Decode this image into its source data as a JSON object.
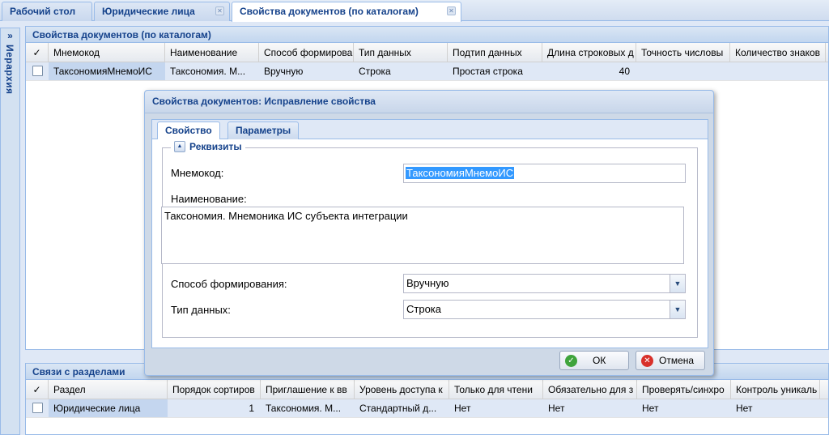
{
  "tabs": [
    {
      "label": "Рабочий стол"
    },
    {
      "label": "Юридические лица"
    },
    {
      "label": "Свойства документов (по каталогам)"
    }
  ],
  "left_region": {
    "title": "Иерархия",
    "expand_glyph": "»"
  },
  "properties_panel": {
    "title": "Свойства документов (по каталогам)",
    "columns": [
      "Мнемокод",
      "Наименование",
      "Способ формирова",
      "Тип данных",
      "Подтип данных",
      "Длина строковых д",
      "Точность числовы",
      "Количество знаков"
    ],
    "rows": [
      {
        "mnemocode": "ТаксономияМнемоИС",
        "name": "Таксономия. М...",
        "method": "Вручную",
        "data_type": "Строка",
        "subtype": "Простая строка",
        "length": "40",
        "precision": "",
        "digits": ""
      }
    ]
  },
  "links_panel": {
    "title": "Связи с разделами",
    "columns": [
      "Раздел",
      "Порядок сортиров",
      "Приглашение к вв",
      "Уровень доступа к",
      "Только для чтени",
      "Обязательно для з",
      "Проверять/синхро",
      "Контроль уникаль"
    ],
    "rows": [
      {
        "section": "Юридические лица",
        "order": "1",
        "prompt": "Таксономия. М...",
        "access": "Стандартный д...",
        "readonly": "Нет",
        "required": "Нет",
        "check": "Нет",
        "unique": "Нет"
      }
    ]
  },
  "dialog": {
    "title": "Свойства документов: Исправление свойства",
    "tabs": [
      "Свойство",
      "Параметры"
    ],
    "fieldset_title": "Реквизиты",
    "fields": {
      "mnemocode_label": "Мнемокод:",
      "mnemocode_value": "ТаксономияМнемоИС",
      "name_label": "Наименование:",
      "name_value": "Таксономия. Мнемоника ИС субъекта интеграции",
      "method_label": "Способ формирования:",
      "method_value": "Вручную",
      "datatype_label": "Тип данных:",
      "datatype_value": "Строка"
    },
    "ok_label": "ОК",
    "cancel_label": "Отмена",
    "colors": {
      "ok_icon": "#3fa43c",
      "cancel_icon": "#d8302a"
    }
  },
  "icons": {
    "ok": "check-circle-icon",
    "cancel": "close-circle-icon",
    "tab_close": "close-icon",
    "collapse": "collapse-up-icon",
    "dropdown": "chevron-down-icon"
  }
}
